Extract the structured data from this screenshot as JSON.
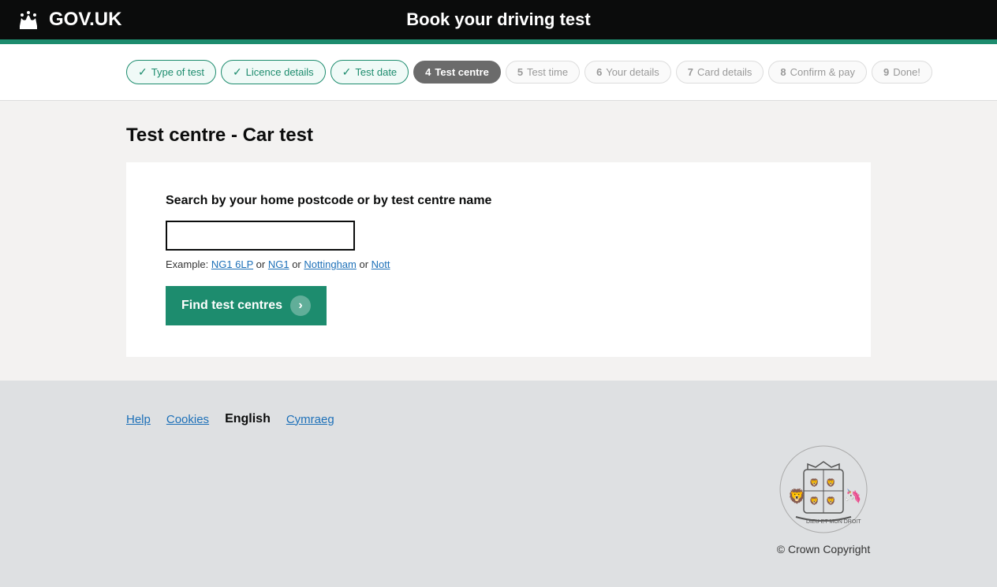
{
  "header": {
    "logo_text": "GOV.UK",
    "title": "Book your driving test"
  },
  "stepper": {
    "steps": [
      {
        "num": "",
        "label": "Type of test",
        "state": "completed"
      },
      {
        "num": "",
        "label": "Licence details",
        "state": "completed"
      },
      {
        "num": "",
        "label": "Test date",
        "state": "completed"
      },
      {
        "num": "4",
        "label": "Test centre",
        "state": "active"
      },
      {
        "num": "5",
        "label": "Test time",
        "state": "inactive"
      },
      {
        "num": "6",
        "label": "Your details",
        "state": "inactive"
      },
      {
        "num": "7",
        "label": "Card details",
        "state": "inactive"
      },
      {
        "num": "8",
        "label": "Confirm & pay",
        "state": "inactive"
      },
      {
        "num": "9",
        "label": "Done!",
        "state": "inactive"
      }
    ]
  },
  "main": {
    "page_title": "Test centre - Car test",
    "search_label": "Search by your home postcode or by test centre name",
    "search_placeholder": "",
    "example_text": "Example: ",
    "example_links": [
      "NG1 6LP",
      "NG1",
      "Nottingham",
      "Nott"
    ],
    "example_or": " or ",
    "find_button_label": "Find test centres"
  },
  "footer": {
    "links": [
      {
        "label": "Help",
        "active": false
      },
      {
        "label": "Cookies",
        "active": false
      },
      {
        "label": "English",
        "active": true
      },
      {
        "label": "Cymraeg",
        "active": false
      }
    ],
    "copyright_text": "© Crown Copyright"
  }
}
